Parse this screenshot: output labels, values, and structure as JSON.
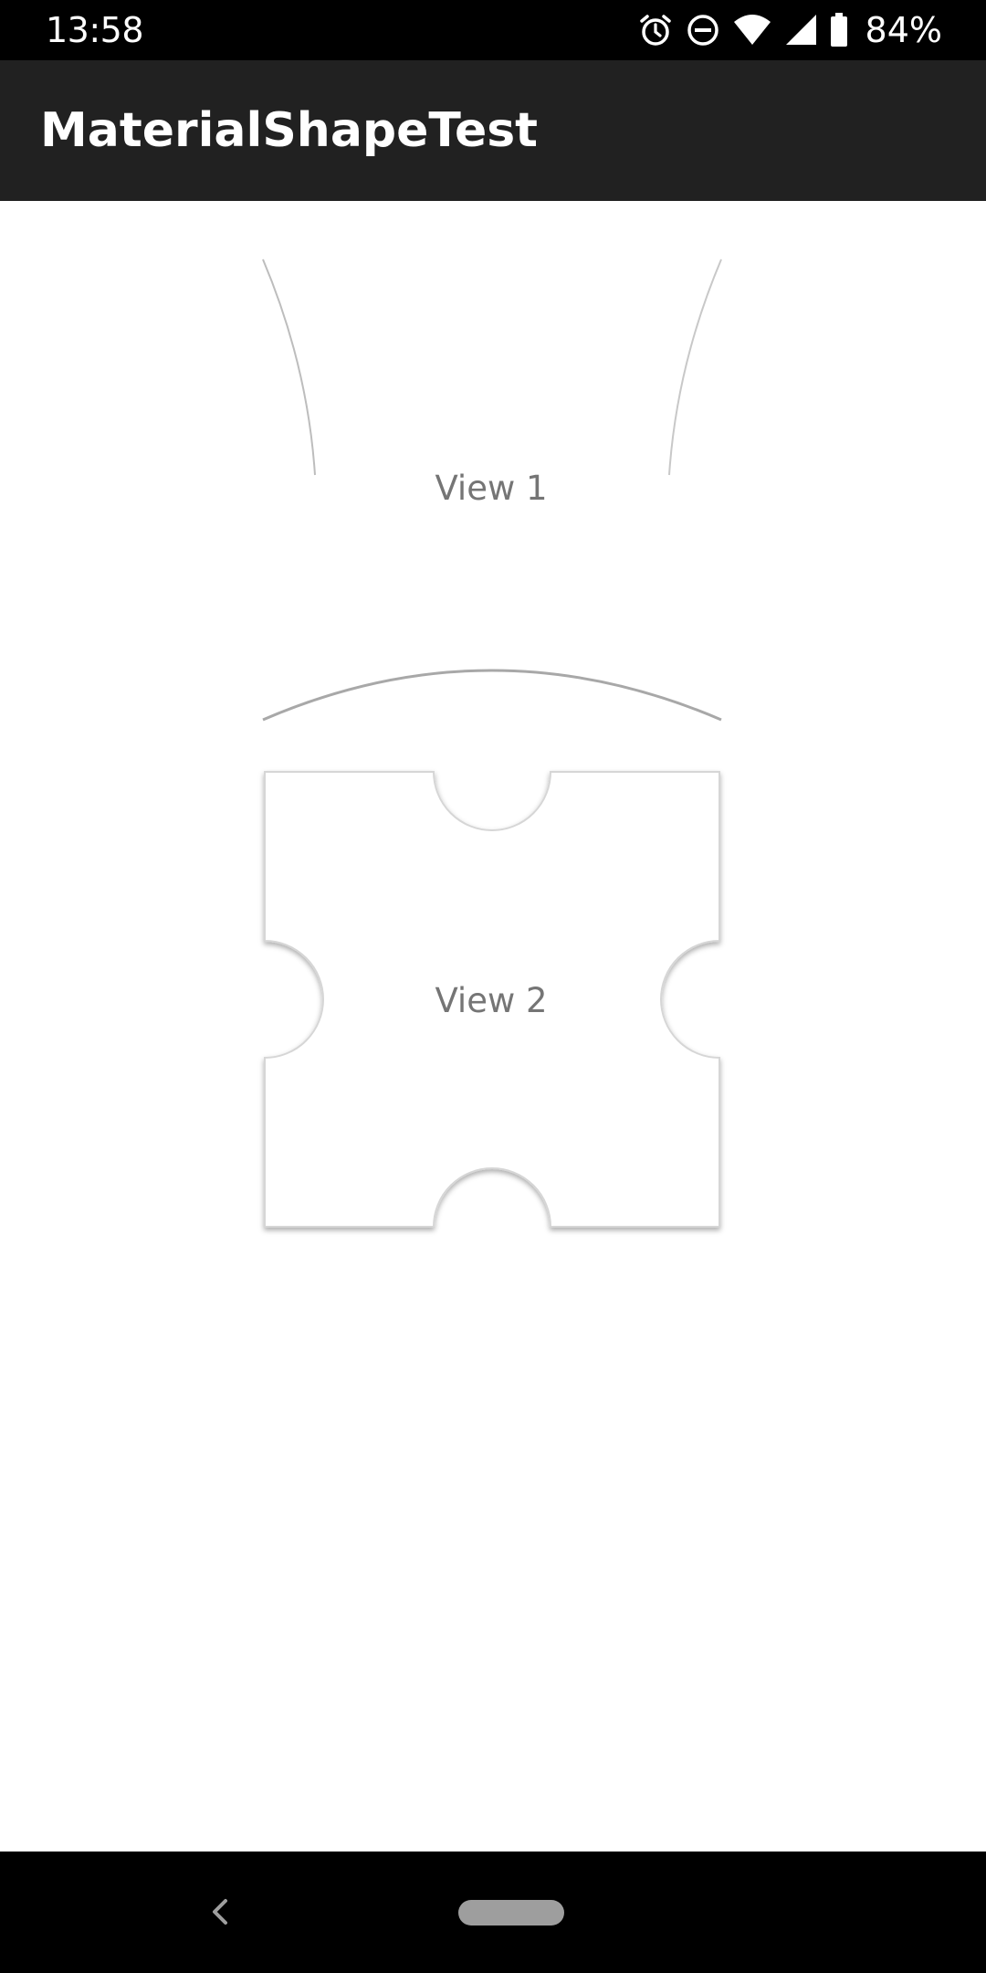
{
  "status_bar": {
    "time": "13:58",
    "battery_percent": "84%",
    "icons": [
      "alarm-icon",
      "do-not-disturb-icon",
      "wifi-icon",
      "signal-icon",
      "battery-icon"
    ]
  },
  "app_bar": {
    "title": "MaterialShapeTest",
    "background_color": "#212121"
  },
  "views": [
    {
      "label": "View 1"
    },
    {
      "label": "View 2"
    }
  ],
  "nav_bar": {
    "icons": [
      "back-icon",
      "home-pill-icon"
    ]
  },
  "colors": {
    "content_background": "#ffffff",
    "label_text": "#757575",
    "shape_outline": "#bdbdbd"
  }
}
